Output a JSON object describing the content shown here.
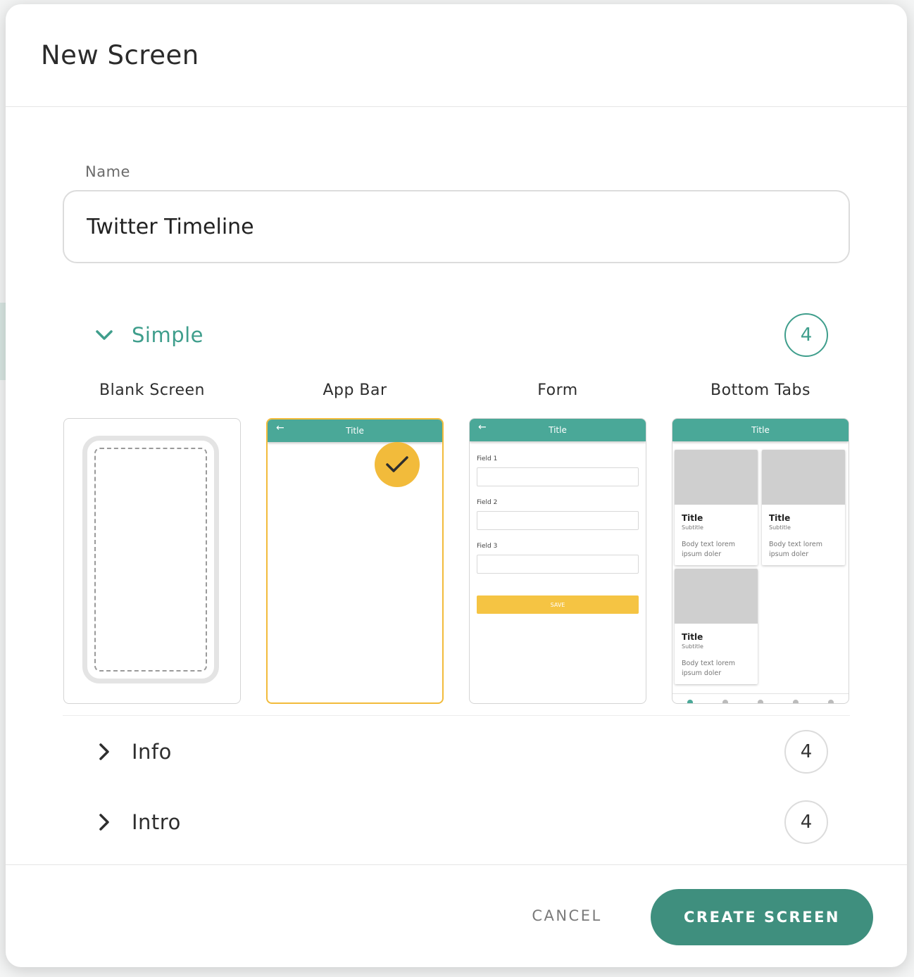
{
  "dialog": {
    "title": "New Screen"
  },
  "name_field": {
    "label": "Name",
    "value": "Twitter Timeline"
  },
  "sections": [
    {
      "label": "Simple",
      "count": "4",
      "expanded": true
    },
    {
      "label": "Info",
      "count": "4",
      "expanded": false
    },
    {
      "label": "Intro",
      "count": "4",
      "expanded": false
    }
  ],
  "templates": [
    {
      "label": "Blank Screen"
    },
    {
      "label": "App Bar",
      "appbar_title": "Title",
      "selected": true
    },
    {
      "label": "Form",
      "appbar_title": "Title",
      "fields": [
        "Field 1",
        "Field 2",
        "Field 3"
      ],
      "save_label": "SAVE"
    },
    {
      "label": "Bottom Tabs",
      "appbar_title": "Title",
      "card": {
        "title": "Title",
        "subtitle": "Subtitle",
        "body": "Body text lorem ipsum doler"
      }
    }
  ],
  "footer": {
    "cancel_label": "CANCEL",
    "create_label": "CREATE SCREEN"
  },
  "colors": {
    "accent": "#3f9e8c",
    "button": "#3f8f7e",
    "selected": "#f2bb3b",
    "appbar": "#4aa898"
  },
  "icons": {
    "expanded": "chevron-down-icon",
    "collapsed": "chevron-right-icon",
    "selected": "check-icon",
    "back": "arrow-left-icon"
  }
}
